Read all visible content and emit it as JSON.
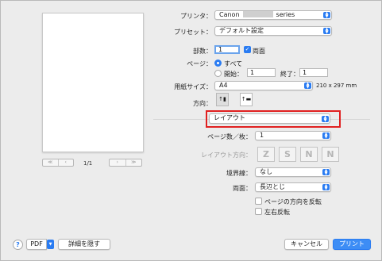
{
  "preview": {
    "page_indicator": "1/1",
    "nav_prev": [
      "≪",
      "‹"
    ],
    "nav_next": [
      "›",
      "≫"
    ]
  },
  "printer": {
    "label": "プリンタ：",
    "value_prefix": "Canon",
    "value_suffix": "series"
  },
  "preset": {
    "label": "プリセット：",
    "value": "デフォルト設定"
  },
  "copies": {
    "label": "部数：",
    "value": "1",
    "duplex_label": "両面",
    "duplex_checked": true
  },
  "pages": {
    "label": "ページ：",
    "all_label": "すべて",
    "from_label": "開始：",
    "from_value": "1",
    "to_label": "終了：",
    "to_value": "1"
  },
  "paper_size": {
    "label": "用紙サイズ：",
    "value": "A4",
    "dimensions": "210 x 297 mm"
  },
  "orientation": {
    "label": "方向："
  },
  "panel_select": {
    "value": "レイアウト"
  },
  "pages_per_sheet": {
    "label": "ページ数／枚：",
    "value": "1"
  },
  "layout_direction": {
    "label": "レイアウト方向：",
    "options": [
      "Z",
      "S",
      "N",
      "N"
    ]
  },
  "border": {
    "label": "境界線：",
    "value": "なし"
  },
  "two_sided": {
    "label": "両面：",
    "value": "長辺とじ"
  },
  "reverse_orientation": {
    "label": "ページの方向を反転"
  },
  "flip_horizontal": {
    "label": "左右反転"
  },
  "footer": {
    "help": "?",
    "pdf": "PDF",
    "hide_details": "詳細を隠す",
    "cancel": "キャンセル",
    "print": "プリント"
  },
  "colors": {
    "accent": "#2a7cf2",
    "highlight": "#e02020"
  }
}
